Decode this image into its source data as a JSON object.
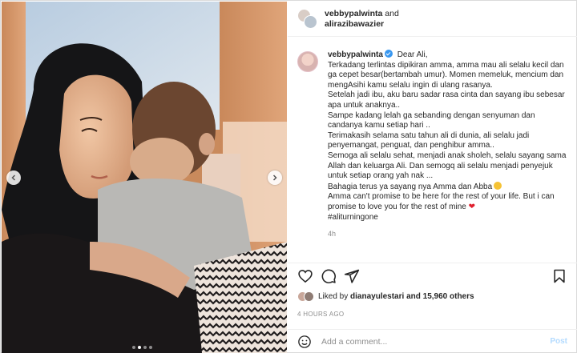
{
  "header": {
    "user1": "vebbypalwinta",
    "joiner": "and",
    "user2": "alirazibawazier"
  },
  "caption": {
    "username": "vebbypalwinta",
    "verified": true,
    "lines": [
      "Dear Ali,",
      "Terkadang terlintas dipikiran amma, amma mau ali selalu kecil dan ga cepet besar(bertambah umur). Momen memeluk, mencium dan mengAsihi kamu selalu ingin di ulang rasanya.",
      "Setelah jadi ibu, aku baru sadar rasa cinta dan sayang ibu sebesar apa untuk anaknya..",
      "Sampe kadang lelah ga sebanding dengan senyuman dan candanya kamu setiap hari ..",
      "Terimakasih selama satu tahun ali di dunia, ali selalu jadi penyemangat, penguat, dan penghibur amma..",
      "Semoga ali selalu sehat, menjadi anak sholeh, selalu sayang sama Allah dan keluarga Ali. Dan semogq ali selalu menjadi penyejuk untuk setiap orang yah nak ...",
      "Bahagia terus ya sayang nya Amma dan Abba",
      "Amma can't promise to be here for the rest of your life. But i can promise to love you for the rest of mine",
      "#aliturningone"
    ],
    "timestamp": "4h"
  },
  "actions": {
    "like_icon": "heart-outline-icon",
    "comment_icon": "comment-bubble-icon",
    "share_icon": "paper-plane-icon",
    "save_icon": "bookmark-icon"
  },
  "likes": {
    "prefix": "Liked by",
    "user": "dianayulestari",
    "suffix": "and 15,960 others"
  },
  "posted_ago": "4 HOURS AGO",
  "comment": {
    "emoji_icon": "smiley-face-icon",
    "placeholder": "Add a comment...",
    "post_label": "Post"
  },
  "carousel": {
    "total": 4,
    "active_index": 1
  },
  "colors": {
    "verified": "#3897f0",
    "post_disabled": "#b3dbff",
    "heart": "#e0202e"
  }
}
